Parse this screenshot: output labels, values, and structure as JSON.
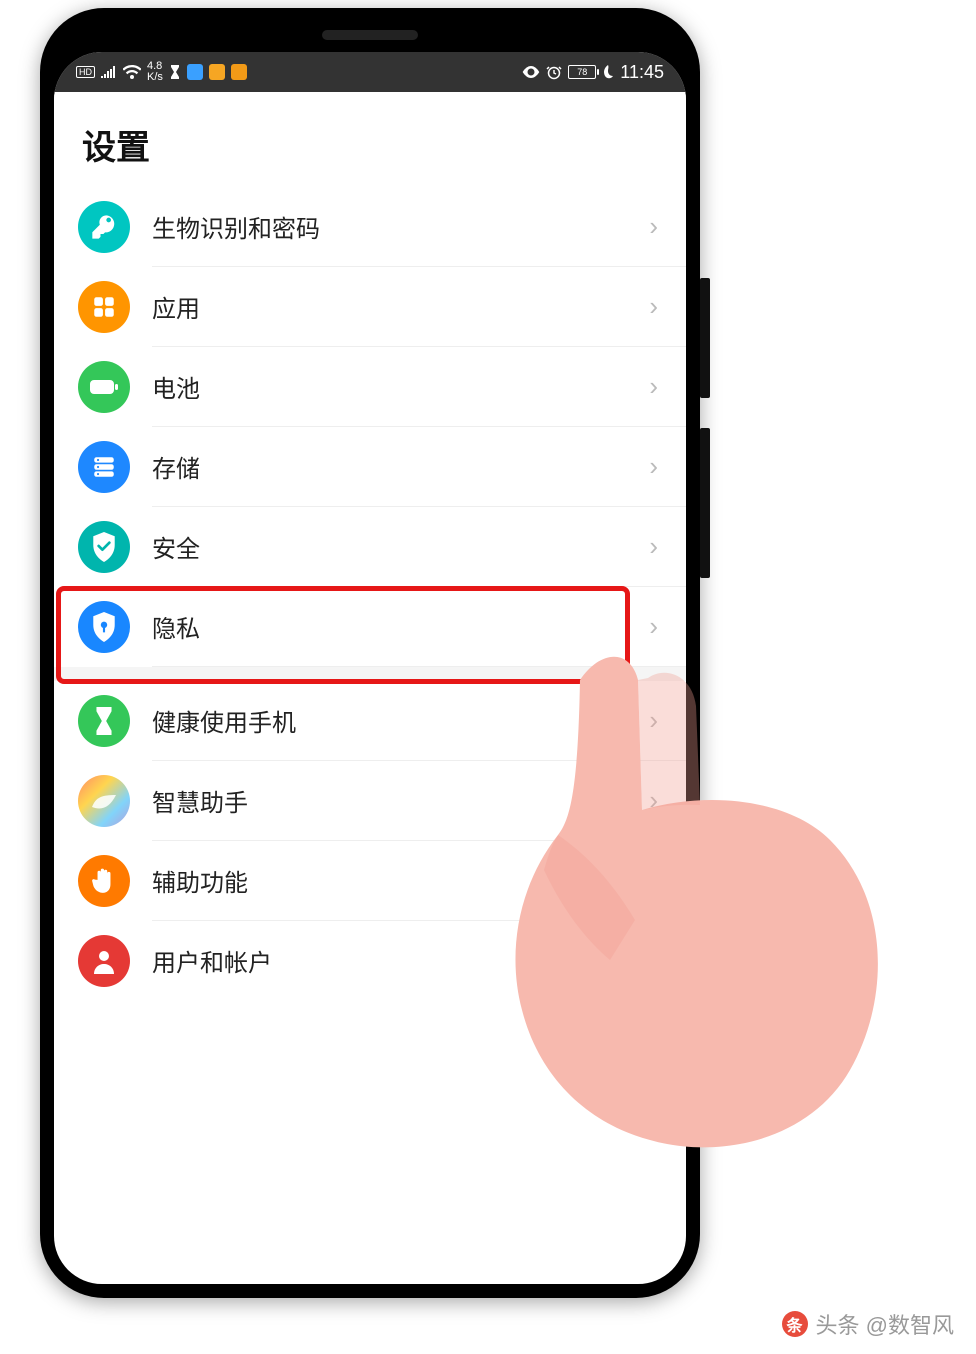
{
  "status_bar": {
    "net_speed_top": "4.8",
    "net_speed_bottom": "K/s",
    "hd": "HD",
    "battery_text": "78",
    "time": "11:45"
  },
  "page": {
    "title": "设置"
  },
  "items": [
    {
      "label": "生物识别和密码",
      "icon": "key-icon"
    },
    {
      "label": "应用",
      "icon": "apps-icon"
    },
    {
      "label": "电池",
      "icon": "battery-icon"
    },
    {
      "label": "存储",
      "icon": "storage-icon"
    },
    {
      "label": "安全",
      "icon": "shield-check-icon"
    },
    {
      "label": "隐私",
      "icon": "shield-lock-icon"
    },
    {
      "label": "健康使用手机",
      "icon": "hourglass-icon"
    },
    {
      "label": "智慧助手",
      "icon": "assistant-icon"
    },
    {
      "label": "辅助功能",
      "icon": "hand-icon"
    },
    {
      "label": "用户和帐户",
      "icon": "person-icon"
    }
  ],
  "watermark": {
    "text": "头条 @数智风"
  }
}
